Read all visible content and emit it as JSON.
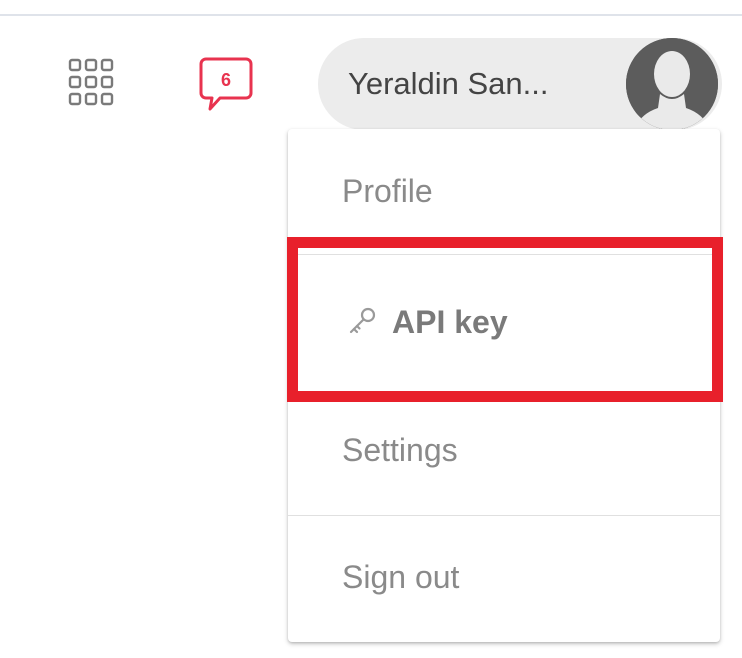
{
  "header": {
    "notification_count": "6",
    "user_name": "Yeraldin San...",
    "apps_icon": "grid-apps-icon",
    "notification_icon": "chat-bubble-icon",
    "avatar_icon": "user-silhouette-icon"
  },
  "menu": {
    "profile_label": "Profile",
    "api_key_label": "API key",
    "api_key_icon": "key-icon",
    "settings_label": "Settings",
    "sign_out_label": "Sign out"
  },
  "colors": {
    "accent": "#e8334f",
    "highlight": "#e8202b",
    "pill_background": "#ececec",
    "menu_text": "#8a8a8a"
  }
}
